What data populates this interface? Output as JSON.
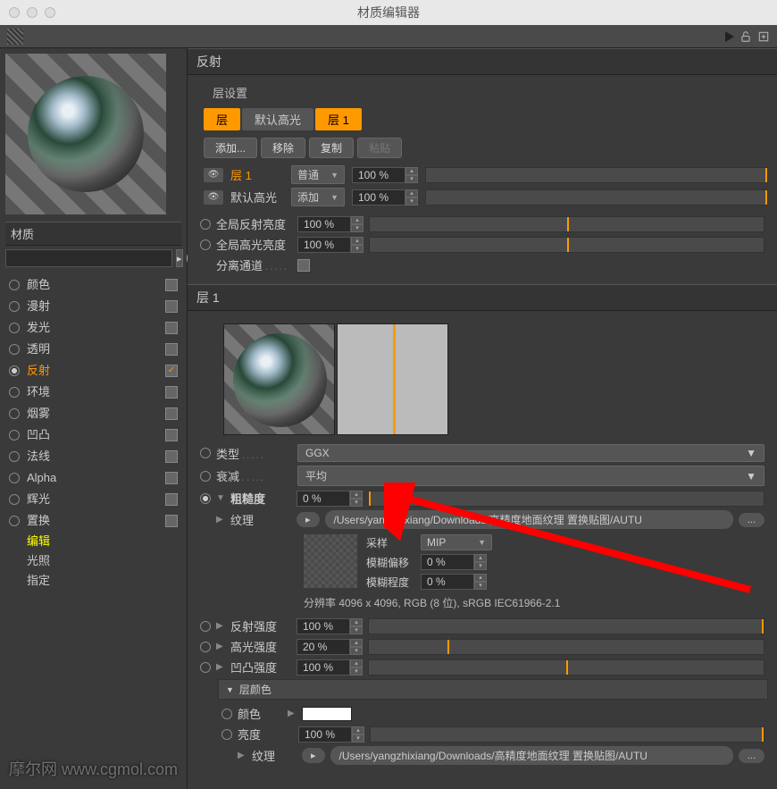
{
  "window": {
    "title": "材质编辑器"
  },
  "sidebar": {
    "section_label": "材质",
    "channels": [
      {
        "label": "颜色",
        "checked": false
      },
      {
        "label": "漫射",
        "checked": false
      },
      {
        "label": "发光",
        "checked": false
      },
      {
        "label": "透明",
        "checked": false
      },
      {
        "label": "反射",
        "checked": true,
        "active": true
      },
      {
        "label": "环境",
        "checked": false
      },
      {
        "label": "烟雾",
        "checked": false
      },
      {
        "label": "凹凸",
        "checked": false
      },
      {
        "label": "法线",
        "checked": false
      },
      {
        "label": "Alpha",
        "checked": false
      },
      {
        "label": "辉光",
        "checked": false
      },
      {
        "label": "置换",
        "checked": false
      }
    ],
    "sub_items": [
      {
        "label": "编辑",
        "active": true
      },
      {
        "label": "光照",
        "active": false
      },
      {
        "label": "指定",
        "active": false
      }
    ]
  },
  "reflection": {
    "header": "反射",
    "layer_settings_label": "层设置",
    "tabs": [
      {
        "label": "层",
        "active": true
      },
      {
        "label": "默认高光",
        "active": false
      },
      {
        "label": "层 1",
        "active": true
      }
    ],
    "buttons": {
      "add": "添加...",
      "remove": "移除",
      "copy": "复制",
      "paste": "粘贴"
    },
    "layers": [
      {
        "name": "层 1",
        "mode": "普通",
        "opacity": "100 %",
        "highlight": true
      },
      {
        "name": "默认高光",
        "mode": "添加",
        "opacity": "100 %",
        "highlight": false
      }
    ],
    "global_reflection": {
      "label": "全局反射亮度",
      "value": "100 %"
    },
    "global_specular": {
      "label": "全局高光亮度",
      "value": "100 %"
    },
    "separate_channel": {
      "label": "分离通道"
    }
  },
  "layer1": {
    "header": "层 1",
    "type": {
      "label": "类型",
      "value": "GGX"
    },
    "attenuation": {
      "label": "衰减",
      "value": "平均"
    },
    "roughness": {
      "label": "粗糙度",
      "value": "0 %"
    },
    "texture": {
      "label": "纹理",
      "path": "/Users/yangzhixiang/Downloads/高精度地面纹理 置换贴图/AUTU",
      "sampling_label": "采样",
      "sampling_value": "MIP",
      "blur_offset_label": "模糊偏移",
      "blur_offset_value": "0 %",
      "blur_scale_label": "模糊程度",
      "blur_scale_value": "0 %",
      "info": "分辨率 4096 x 4096, RGB (8 位), sRGB IEC61966-2.1"
    },
    "reflection_strength": {
      "label": "反射强度",
      "value": "100 %"
    },
    "specular_strength": {
      "label": "高光强度",
      "value": "20 %"
    },
    "bump_strength": {
      "label": "凹凸强度",
      "value": "100 %"
    },
    "layer_color": {
      "header": "层颜色",
      "color_label": "颜色",
      "brightness_label": "亮度",
      "brightness_value": "100 %",
      "texture_label": "纹理",
      "texture_path": "/Users/yangzhixiang/Downloads/高精度地面纹理 置换贴图/AUTU"
    }
  },
  "watermark": "摩尔网 www.cgmol.com",
  "ellipsis": "..."
}
